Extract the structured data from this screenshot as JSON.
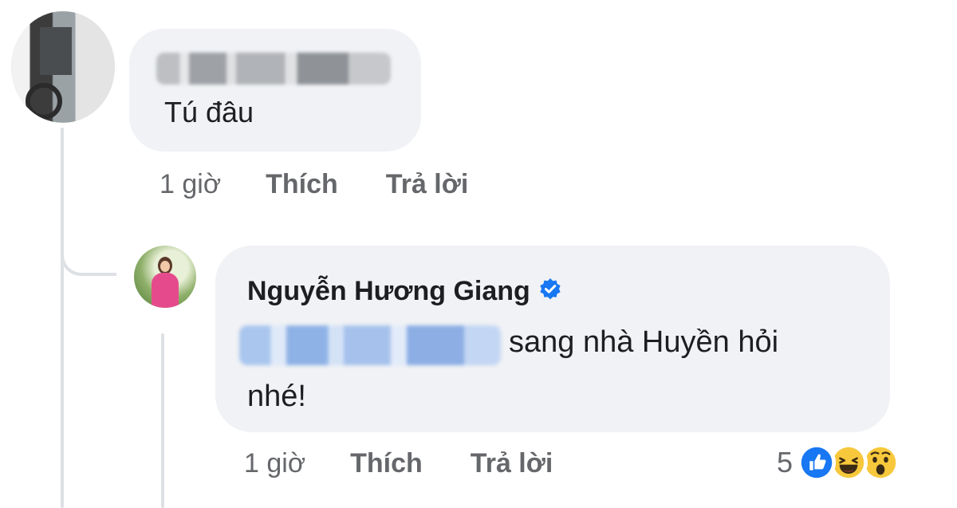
{
  "comment_1": {
    "text": "Tú đâu",
    "time": "1 giờ",
    "like_label": "Thích",
    "reply_label": "Trả lời"
  },
  "comment_2": {
    "author": "Nguyễn Hương Giang",
    "text_line1": "sang nhà Huyền hỏi",
    "text_line2": "nhé!",
    "time": "1 giờ",
    "like_label": "Thích",
    "reply_label": "Trả lời",
    "reaction_count": "5",
    "reactions": [
      "like-icon",
      "haha-icon",
      "wow-icon"
    ]
  },
  "colors": {
    "bubble_bg": "#f0f2f5",
    "meta_text": "#65676b",
    "like_blue": "#1877f2",
    "verified_blue": "#1877f2",
    "emoji_yellow": "#f7c83c"
  }
}
